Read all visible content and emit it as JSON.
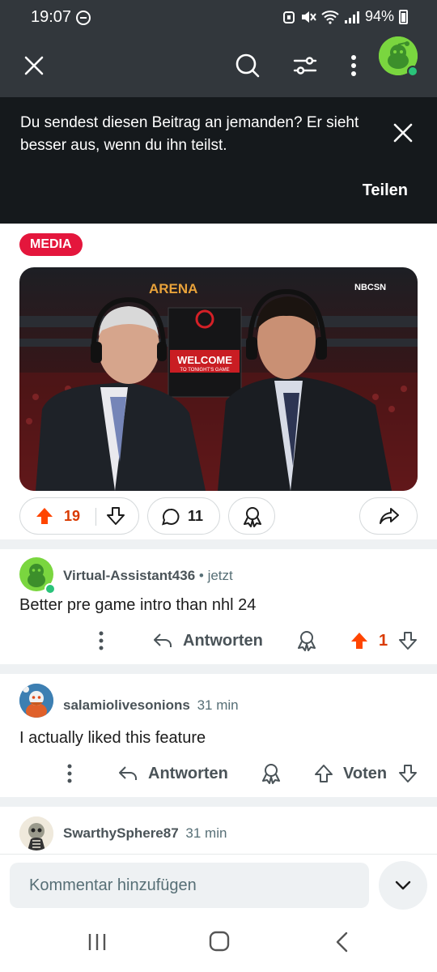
{
  "status_bar": {
    "time": "19:07",
    "battery": "94%"
  },
  "toolbar": {
    "icons": [
      "close-icon",
      "search-icon",
      "sort-icon",
      "more-vertical-icon",
      "avatar"
    ]
  },
  "share_banner": {
    "message": "Du sendest diesen Beitrag an jemanden? Er sieht besser aus, wenn du ihn teilst.",
    "share_label": "Teilen"
  },
  "post": {
    "flair": "MEDIA",
    "video_overlay": {
      "arena_text": "ARENA",
      "network": "NBCSN",
      "welcome": "WELCOME",
      "welcome_sub": "TO TONIGHT'S GAME"
    },
    "votes": "19",
    "comments": "11"
  },
  "comments": [
    {
      "username": "Virtual-Assistant436",
      "time": "• jetzt",
      "body": "Better pre game intro than nhl 24",
      "reply_label": "Antworten",
      "vote_label": "1"
    },
    {
      "username": "salamiolivesonions",
      "time": "31 min",
      "body": "I actually liked this feature",
      "reply_label": "Antworten",
      "vote_label": "Voten"
    },
    {
      "username": "SwarthySphere87",
      "time": "31 min"
    }
  ],
  "composer": {
    "placeholder": "Kommentar hinzufügen"
  },
  "colors": {
    "upvote": "#ff4500",
    "media_tag": "#e4163c",
    "banner_bg": "#15191c",
    "toolbar_bg": "#32373c"
  }
}
